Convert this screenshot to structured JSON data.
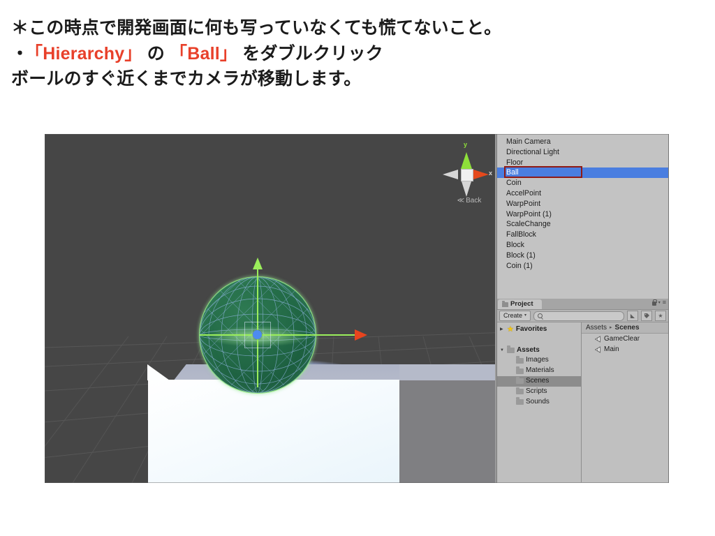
{
  "slide": {
    "lines": [
      {
        "id": "l1",
        "text": "＊この時点で開発画面に何も写っていなくても慌てないこと。"
      },
      {
        "id": "l2",
        "bullet": "・",
        "pre": "",
        "hl1": "「Hierarchy」",
        "mid": " の ",
        "hl2": "「Ball」",
        "post": " をダブルクリック"
      },
      {
        "id": "l3",
        "text": "ボールのすぐ近くまでカメラが移動します。"
      }
    ],
    "highlight_color": "#e8402a",
    "text_color": "#1b1b1b"
  },
  "scene_view": {
    "background_color": "#464646",
    "grid_color": "#5d5d5d",
    "selected_object": "Ball",
    "gizmo": {
      "y_axis_label": "y",
      "x_axis_label": "x",
      "view_label": "Back",
      "view_arrow": "≪",
      "y_color": "#8ee03a",
      "x_color": "#e5491c",
      "neutral_color": "#d6d6d6"
    },
    "move_gizmo": {
      "y_color": "#9bee5b",
      "x_color": "#e8441e",
      "center_color": "#4d8bf0"
    },
    "ball": {
      "wireframe_color": "#8fb4e0",
      "surface_color": "#226946",
      "outline_color": "#8fe877"
    }
  },
  "hierarchy": {
    "selection_color": "#4a7ee0",
    "annotation_color": "#8f1a15",
    "items": [
      {
        "label": "Main Camera",
        "selected": false
      },
      {
        "label": "Directional Light",
        "selected": false
      },
      {
        "label": "Floor",
        "selected": false
      },
      {
        "label": "Ball",
        "selected": true
      },
      {
        "label": "Coin",
        "selected": false
      },
      {
        "label": "AccelPoint",
        "selected": false
      },
      {
        "label": "WarpPoint",
        "selected": false
      },
      {
        "label": "WarpPoint (1)",
        "selected": false
      },
      {
        "label": "ScaleChange",
        "selected": false
      },
      {
        "label": "FallBlock",
        "selected": false
      },
      {
        "label": "Block",
        "selected": false
      },
      {
        "label": "Block (1)",
        "selected": false
      },
      {
        "label": "Coin (1)",
        "selected": false
      }
    ]
  },
  "project": {
    "tab_label": "Project",
    "tab_icon": "folder-icon",
    "lock_icon": "lock-icon",
    "menu_icon": "panel-menu-icon",
    "create_label": "Create",
    "create_caret": "▾",
    "search_placeholder": "",
    "toolbar_buttons": [
      {
        "name": "filter-by-type-icon",
        "glyph": "◣"
      },
      {
        "name": "filter-by-label-icon",
        "glyph": "🏷"
      },
      {
        "name": "filter-by-favorite-icon",
        "glyph": "★"
      }
    ],
    "tree": [
      {
        "label": "Favorites",
        "icon": "star-icon",
        "expander": "▶",
        "bold": true,
        "indent": false,
        "selected": false
      },
      {
        "label": "",
        "icon": "",
        "expander": "",
        "bold": false,
        "indent": false,
        "selected": false,
        "spacer": true
      },
      {
        "label": "Assets",
        "icon": "folder-icon",
        "expander": "▼",
        "bold": true,
        "indent": false,
        "selected": false
      },
      {
        "label": "Images",
        "icon": "folder-icon",
        "expander": "",
        "bold": false,
        "indent": true,
        "selected": false
      },
      {
        "label": "Materials",
        "icon": "folder-icon",
        "expander": "",
        "bold": false,
        "indent": true,
        "selected": false
      },
      {
        "label": "Scenes",
        "icon": "folder-icon",
        "expander": "",
        "bold": false,
        "indent": true,
        "selected": true
      },
      {
        "label": "Scripts",
        "icon": "folder-icon",
        "expander": "",
        "bold": false,
        "indent": true,
        "selected": false
      },
      {
        "label": "Sounds",
        "icon": "folder-icon",
        "expander": "",
        "bold": false,
        "indent": true,
        "selected": false
      }
    ],
    "breadcrumb": {
      "root": "Assets",
      "separator": "▸",
      "current": "Scenes"
    },
    "assets": [
      {
        "label": "GameClear",
        "icon": "unity-scene-icon"
      },
      {
        "label": "Main",
        "icon": "unity-scene-icon"
      }
    ]
  }
}
